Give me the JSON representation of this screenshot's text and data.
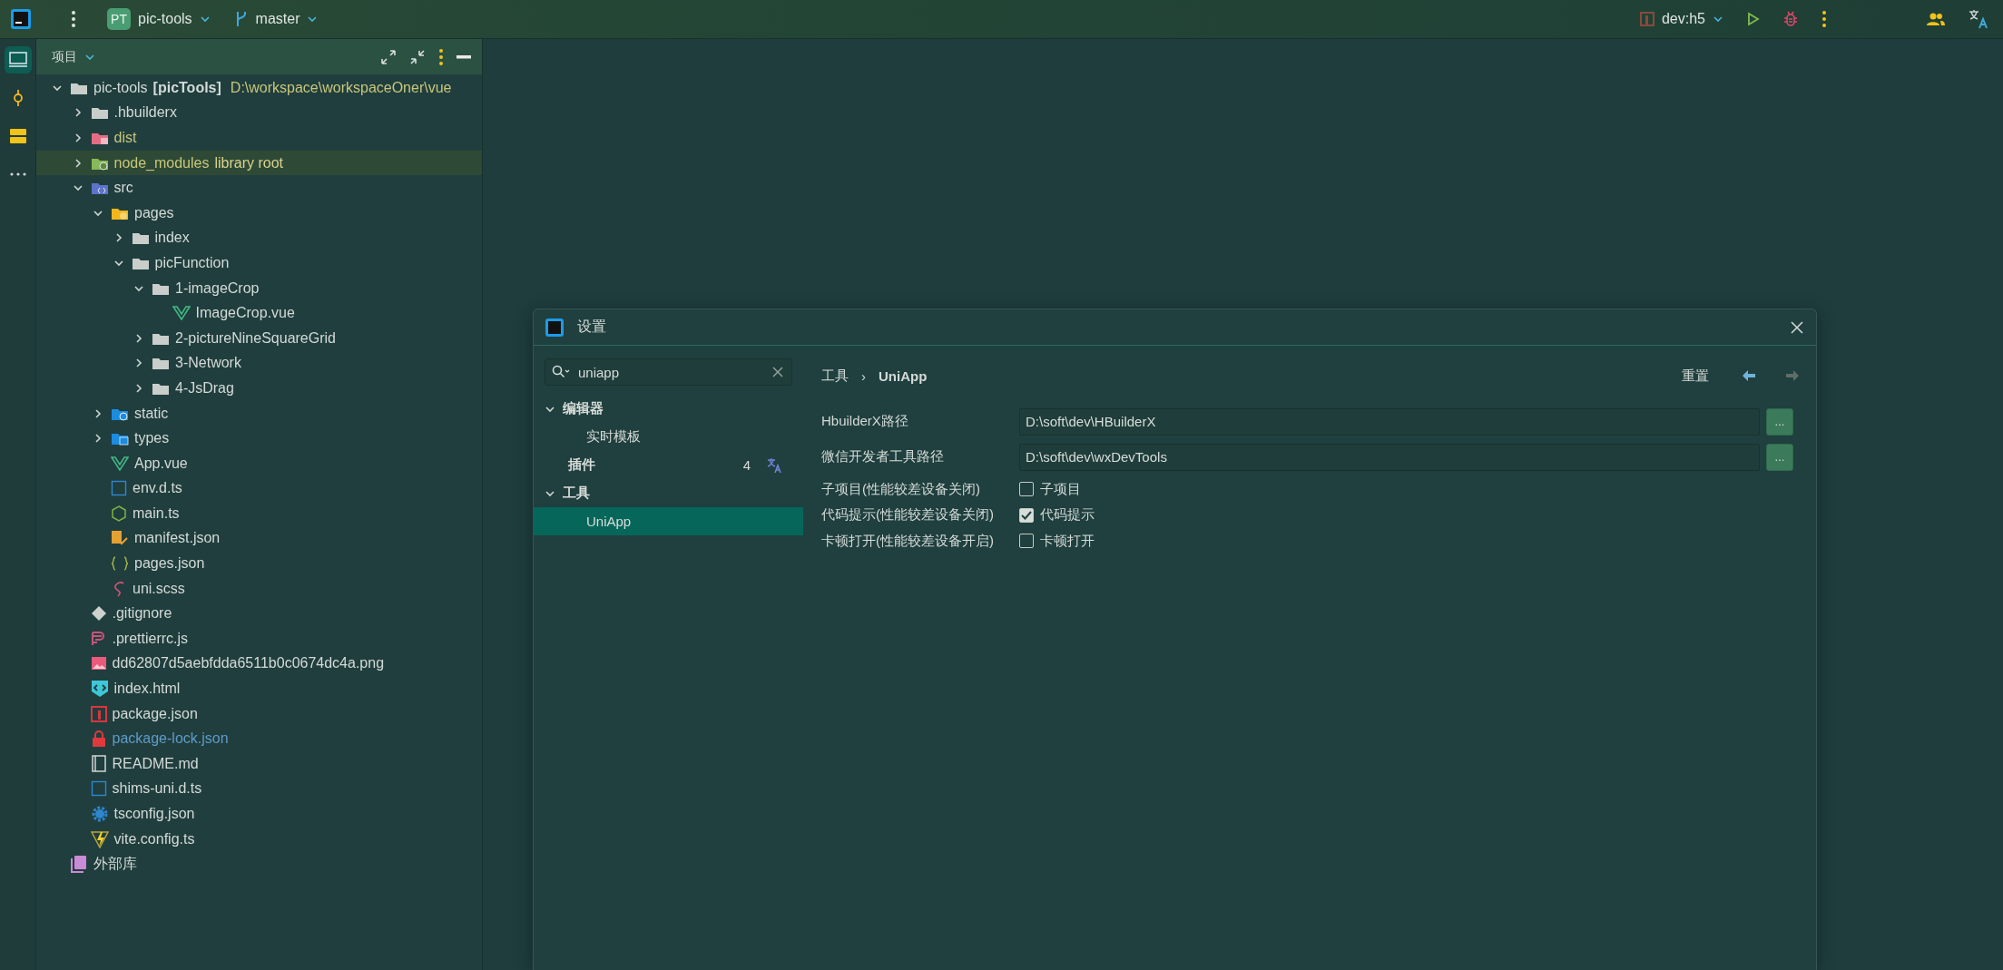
{
  "top_bar": {
    "project_badge": "PT",
    "project": "pic-tools",
    "branch": "master",
    "run_config": "dev:h5"
  },
  "tool_strip": [
    {
      "kind": "project",
      "selected": true
    },
    {
      "kind": "commit",
      "selected": false
    },
    {
      "kind": "structure",
      "selected": false
    },
    {
      "kind": "more",
      "selected": false
    }
  ],
  "project_panel": {
    "title": "项目",
    "tree": [
      {
        "name": "pic-tools",
        "module": "[picTools]",
        "path": "D:\\workspace\\workspaceOner\\vue",
        "kind": "folder",
        "expanded": true,
        "children": [
          {
            "name": ".hbuilderx",
            "kind": "folder",
            "expanded": false
          },
          {
            "name": "dist",
            "kind": "folder-excluded",
            "expanded": false,
            "color": "#c8c679"
          },
          {
            "name": "node_modules",
            "suffix": "library root",
            "kind": "folder-library",
            "expanded": false,
            "color": "#c8c679"
          },
          {
            "name": "src",
            "kind": "folder-source",
            "expanded": true,
            "children": [
              {
                "name": "pages",
                "kind": "folder-pages",
                "expanded": true,
                "children": [
                  {
                    "name": "index",
                    "kind": "folder",
                    "expanded": false
                  },
                  {
                    "name": "picFunction",
                    "kind": "folder",
                    "expanded": true,
                    "children": [
                      {
                        "name": "1-imageCrop",
                        "kind": "folder",
                        "expanded": true,
                        "children": [
                          {
                            "name": "ImageCrop.vue",
                            "kind": "vue"
                          }
                        ]
                      },
                      {
                        "name": "2-pictureNineSquareGrid",
                        "kind": "folder",
                        "expanded": false
                      },
                      {
                        "name": "3-Network",
                        "kind": "folder",
                        "expanded": false
                      },
                      {
                        "name": "4-JsDrag",
                        "kind": "folder",
                        "expanded": false
                      }
                    ]
                  }
                ]
              },
              {
                "name": "static",
                "kind": "folder-static",
                "expanded": false
              },
              {
                "name": "types",
                "kind": "folder-types",
                "expanded": false
              },
              {
                "name": "App.vue",
                "kind": "vue"
              },
              {
                "name": "env.d.ts",
                "kind": "ts"
              },
              {
                "name": "main.ts",
                "kind": "node"
              },
              {
                "name": "manifest.json",
                "kind": "manifest"
              },
              {
                "name": "pages.json",
                "kind": "json"
              },
              {
                "name": "uni.scss",
                "kind": "scss"
              }
            ]
          },
          {
            "name": ".gitignore",
            "kind": "git"
          },
          {
            "name": ".prettierrc.js",
            "kind": "prettier"
          },
          {
            "name": "dd62807d5aebfdda6511b0c0674dc4a.png",
            "kind": "image"
          },
          {
            "name": "index.html",
            "kind": "html"
          },
          {
            "name": "package.json",
            "kind": "npm"
          },
          {
            "name": "package-lock.json",
            "kind": "lock",
            "color": "#5f9bc7"
          },
          {
            "name": "README.md",
            "kind": "md"
          },
          {
            "name": "shims-uni.d.ts",
            "kind": "ts"
          },
          {
            "name": "tsconfig.json",
            "kind": "tsconfig"
          },
          {
            "name": "vite.config.ts",
            "kind": "vite"
          }
        ]
      },
      {
        "name": "外部库",
        "kind": "library"
      }
    ]
  },
  "settings_dialog": {
    "title": "设置",
    "search": {
      "value": "uniapp"
    },
    "nav": [
      {
        "label": "编辑器",
        "expanded": true,
        "selected": false,
        "children": [
          {
            "label": "实时模板",
            "selected": false
          }
        ]
      },
      {
        "label": "插件",
        "count": "4",
        "selected": false
      },
      {
        "label": "工具",
        "expanded": true,
        "selected": false,
        "children": [
          {
            "label": "UniApp",
            "selected": true
          }
        ]
      }
    ],
    "breadcrumb": [
      "工具",
      "UniApp"
    ],
    "breadcrumb_separator": "›",
    "reset": "重置",
    "forward_disabled": true,
    "path_fields": [
      {
        "label": "HbuilderX路径",
        "value": "D:\\soft\\dev\\HBuilderX",
        "browse": "..."
      },
      {
        "label": "微信开发者工具路径",
        "value": "D:\\soft\\dev\\wxDevTools",
        "browse": "..."
      }
    ],
    "options": [
      {
        "label": "子项目(性能较差设备关闭)",
        "checkbox_label": "子项目",
        "checked": false
      },
      {
        "label": "代码提示(性能较差设备关闭)",
        "checkbox_label": "代码提示",
        "checked": true
      },
      {
        "label": "卡顿打开(性能较差设备开启)",
        "checkbox_label": "卡顿打开",
        "checked": false
      }
    ]
  }
}
